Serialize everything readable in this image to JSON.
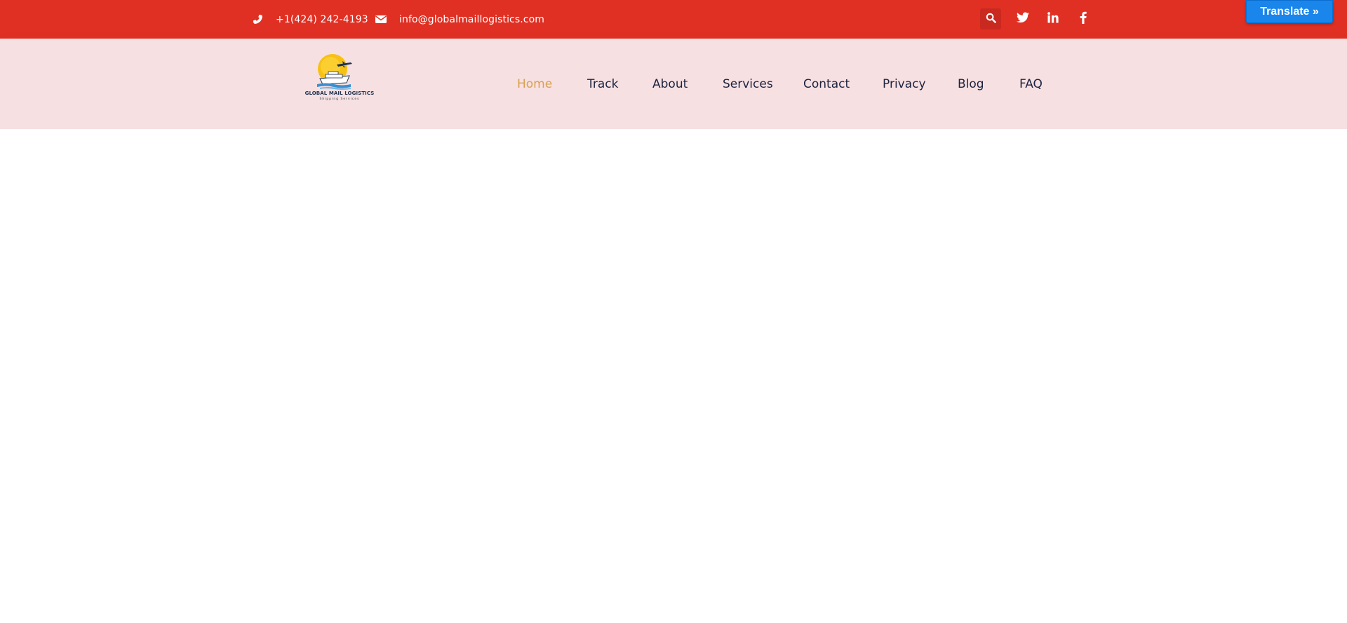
{
  "topbar": {
    "phone": "+1(424) 242-4193",
    "email": "info@globalmaillogistics.com",
    "phone_icon": "phone-icon",
    "email_icon": "envelope-icon",
    "search_icon": "search-icon",
    "social": [
      "twitter-icon",
      "linkedin-icon",
      "facebook-icon"
    ],
    "background_color": "#e03024"
  },
  "translate": {
    "label": "Translate »",
    "color": "#1a85ea"
  },
  "header": {
    "background_color": "#f7e0e2",
    "logo": {
      "title": "GLOBAL MAIL LOGISTICS",
      "subtitle": "Shipping Services"
    },
    "nav": [
      {
        "label": "Home",
        "active": true
      },
      {
        "label": "Track",
        "active": false
      },
      {
        "label": "About",
        "active": false
      },
      {
        "label": "Services",
        "active": false
      },
      {
        "label": "Contact",
        "active": false
      },
      {
        "label": "Privacy",
        "active": false
      },
      {
        "label": "Blog",
        "active": false
      },
      {
        "label": "FAQ",
        "active": false
      }
    ],
    "active_color": "#d9a04e"
  }
}
